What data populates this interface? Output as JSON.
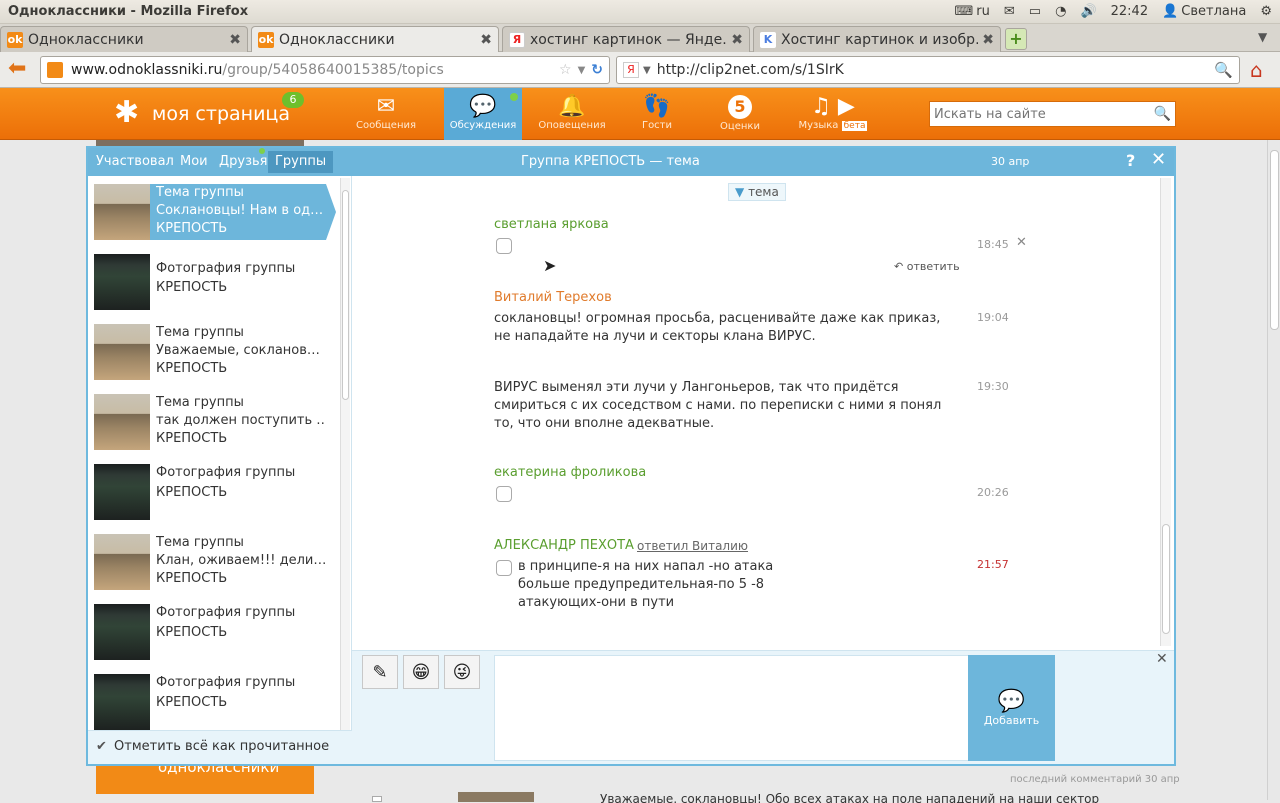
{
  "system": {
    "window_title": "Одноклассники - Mozilla Firefox",
    "lang": "ru",
    "clock": "22:42",
    "user": "Светлана"
  },
  "tabs": [
    {
      "title": "Одноклассники",
      "active": false
    },
    {
      "title": "Одноклассники",
      "active": true
    },
    {
      "title": "хостинг картинок — Янде…",
      "active": false
    },
    {
      "title": "Хостинг картинок и изобр…",
      "active": false
    }
  ],
  "navbar": {
    "url_domain": "www.odnoklassniki.ru",
    "url_path": "/group/54058640015385/topics",
    "url2": "http://clip2net.com/s/1SIrK"
  },
  "header": {
    "mypage_label": "моя страница",
    "mypage_badge": "6",
    "nav": [
      {
        "label": "Сообщения",
        "icon": "envelope-icon"
      },
      {
        "label": "Обсуждения",
        "icon": "speech-bubbles-icon"
      },
      {
        "label": "Оповещения",
        "icon": "bell-icon"
      },
      {
        "label": "Гости",
        "icon": "footprints-icon"
      },
      {
        "label": "Оценки",
        "icon": "rating-5-icon",
        "badge": "5"
      },
      {
        "label": "Музыка",
        "icon": "music-note-icon",
        "beta": "бета"
      }
    ],
    "search_placeholder": "Искать на сайте"
  },
  "dialog": {
    "filters": [
      "Участвовал",
      "Мои",
      "Друзья",
      "Группы"
    ],
    "active_filter": "Группы",
    "title": "Группа КРЕПОСТЬ — тема",
    "date": "30 апр",
    "topic_label": "тема",
    "mark_read": "Отметить всё как прочитанное",
    "add_button": "Добавить",
    "list": [
      {
        "line1": "Тема группы",
        "line2": "Соклановцы! Нам в од…",
        "line3": "КРЕПОСТЬ",
        "thumb": "fortress"
      },
      {
        "line1": "Фотография группы",
        "line2": "",
        "line3": "КРЕПОСТЬ",
        "thumb": "screenshot"
      },
      {
        "line1": "Тема группы",
        "line2": "Уважаемые, сокланов…",
        "line3": "КРЕПОСТЬ",
        "thumb": "fortress"
      },
      {
        "line1": "Тема группы",
        "line2": "так должен поступить …",
        "line3": "КРЕПОСТЬ",
        "thumb": "fortress"
      },
      {
        "line1": "Фотография группы",
        "line2": "",
        "line3": "КРЕПОСТЬ",
        "thumb": "screenshot"
      },
      {
        "line1": "Тема группы",
        "line2": "Клан, оживаем!!! дели…",
        "line3": "КРЕПОСТЬ",
        "thumb": "fortress"
      },
      {
        "line1": "Фотография группы",
        "line2": "",
        "line3": "КРЕПОСТЬ",
        "thumb": "screenshot"
      },
      {
        "line1": "Фотография группы",
        "line2": "",
        "line3": "КРЕПОСТЬ",
        "thumb": "screenshot"
      }
    ],
    "messages": [
      {
        "author": "светлана яркова",
        "color": "#5a9e2f",
        "text": "",
        "time": "18:45",
        "reply": "ответить"
      },
      {
        "author": "Виталий Терехов",
        "color": "#e07b2c",
        "text": "соклановцы! огромная просьба, расценивайте даже как приказ, не нападайте на лучи и секторы клана ВИРУС.",
        "time": "19:04"
      },
      {
        "author": "",
        "text": "ВИРУС выменял эти лучи у Лангоньеров, так что придётся смириться с их соседством с нами. по переписки с ними я понял то, что они вполне адекватные.",
        "time": "19:30"
      },
      {
        "author": "екатерина фроликова",
        "color": "#5a9e2f",
        "text": "",
        "time": "20:26"
      },
      {
        "author": "АЛЕКСАНДР ПЕХОТА",
        "color": "#5a9e2f",
        "reply_to": "ответил Виталию",
        "text": "в принципе-я на них напал -но атака больше предупредительная-по 5 -8 атакующих-они в пути",
        "time": "21:57"
      }
    ]
  },
  "background": {
    "footer_note": "последний комментарий 30 апр",
    "cut_text": "Уважаемые, соклановцы! Обо всех атаках на поле нападений на наши сектор",
    "logo_text": "одноклассники"
  }
}
